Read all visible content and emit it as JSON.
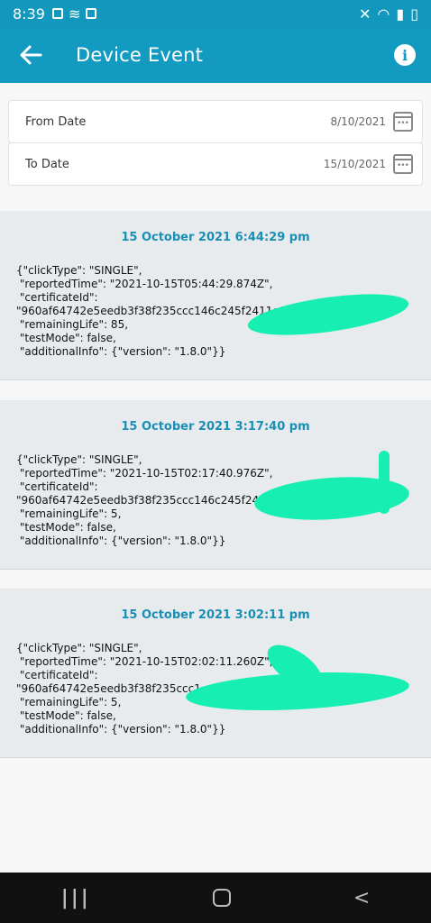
{
  "status": {
    "time": "8:39"
  },
  "appbar": {
    "title": "Device Event"
  },
  "filters": {
    "from_label": "From Date",
    "from_value": "8/10/2021",
    "to_label": "To Date",
    "to_value": "15/10/2021"
  },
  "events": [
    {
      "title": "15 October 2021 6:44:29 pm",
      "payload": "{\"clickType\": \"SINGLE\",\n \"reportedTime\": \"2021-10-15T05:44:29.874Z\",\n \"certificateId\":\n\"960af64742e5eedb3f38f235ccc146c245f2411e9f\n \"remainingLife\": 85,\n \"testMode\": false,\n \"additionalInfo\": {\"version\": \"1.8.0\"}}"
    },
    {
      "title": "15 October 2021 3:17:40 pm",
      "payload": "{\"clickType\": \"SINGLE\",\n \"reportedTime\": \"2021-10-15T02:17:40.976Z\",\n \"certificateId\":\n\"960af64742e5eedb3f38f235ccc146c245f2411e\n \"remainingLife\": 5,\n \"testMode\": false,\n \"additionalInfo\": {\"version\": \"1.8.0\"}}"
    },
    {
      "title": "15 October 2021 3:02:11 pm",
      "payload": "{\"clickType\": \"SINGLE\",\n \"reportedTime\": \"2021-10-15T02:02:11.260Z\",\n \"certificateId\":\n\"960af64742e5eedb3f38f235ccc1\n \"remainingLife\": 5,\n \"testMode\": false,\n \"additionalInfo\": {\"version\": \"1.8.0\"}}"
    }
  ],
  "navbar": {
    "recents": "|||",
    "back": "<"
  }
}
